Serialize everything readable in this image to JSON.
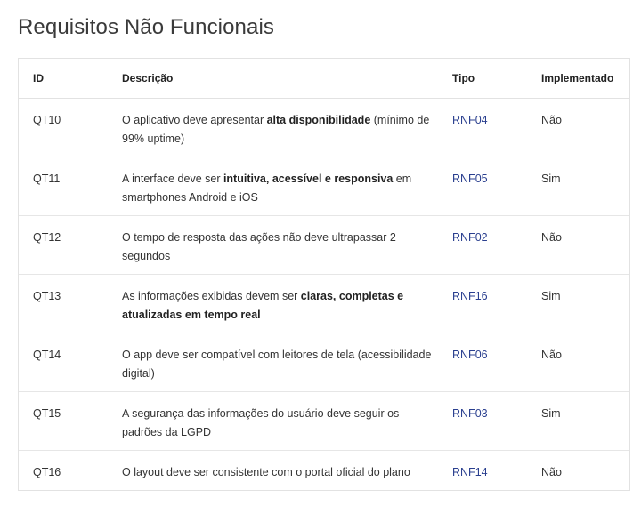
{
  "page": {
    "title": "Requisitos Não Funcionais"
  },
  "table": {
    "headers": {
      "id": "ID",
      "descricao": "Descrição",
      "tipo": "Tipo",
      "implementado": "Implementado"
    },
    "rows": [
      {
        "id": "QT10",
        "descricao": [
          {
            "text": "O aplicativo deve apresentar ",
            "bold": false
          },
          {
            "text": "alta disponibilidade",
            "bold": true
          },
          {
            "text": " (mínimo de 99% uptime)",
            "bold": false
          }
        ],
        "tipo": "RNF04",
        "implementado": "Não"
      },
      {
        "id": "QT11",
        "descricao": [
          {
            "text": "A interface deve ser ",
            "bold": false
          },
          {
            "text": "intuitiva, acessível e responsiva",
            "bold": true
          },
          {
            "text": " em smartphones Android e iOS",
            "bold": false
          }
        ],
        "tipo": "RNF05",
        "implementado": "Sim"
      },
      {
        "id": "QT12",
        "descricao": [
          {
            "text": "O tempo de resposta das ações não deve ultrapassar 2 segundos",
            "bold": false
          }
        ],
        "tipo": "RNF02",
        "implementado": "Não"
      },
      {
        "id": "QT13",
        "descricao": [
          {
            "text": "As informações exibidas devem ser ",
            "bold": false
          },
          {
            "text": "claras, completas e atualizadas em tempo real",
            "bold": true
          }
        ],
        "tipo": "RNF16",
        "implementado": "Sim"
      },
      {
        "id": "QT14",
        "descricao": [
          {
            "text": "O app deve ser compatível com leitores de tela (acessibilidade digital)",
            "bold": false
          }
        ],
        "tipo": "RNF06",
        "implementado": "Não"
      },
      {
        "id": "QT15",
        "descricao": [
          {
            "text": "A segurança das informações do usuário deve seguir os padrões da LGPD",
            "bold": false
          }
        ],
        "tipo": "RNF03",
        "implementado": "Sim"
      },
      {
        "id": "QT16",
        "descricao": [
          {
            "text": "O layout deve ser consistente com o portal oficial do plano",
            "bold": false
          }
        ],
        "tipo": "RNF14",
        "implementado": "Não"
      }
    ]
  },
  "colors": {
    "link": "#2a3f8f",
    "border": "#e2e2e2",
    "title": "#3a3a3a"
  }
}
